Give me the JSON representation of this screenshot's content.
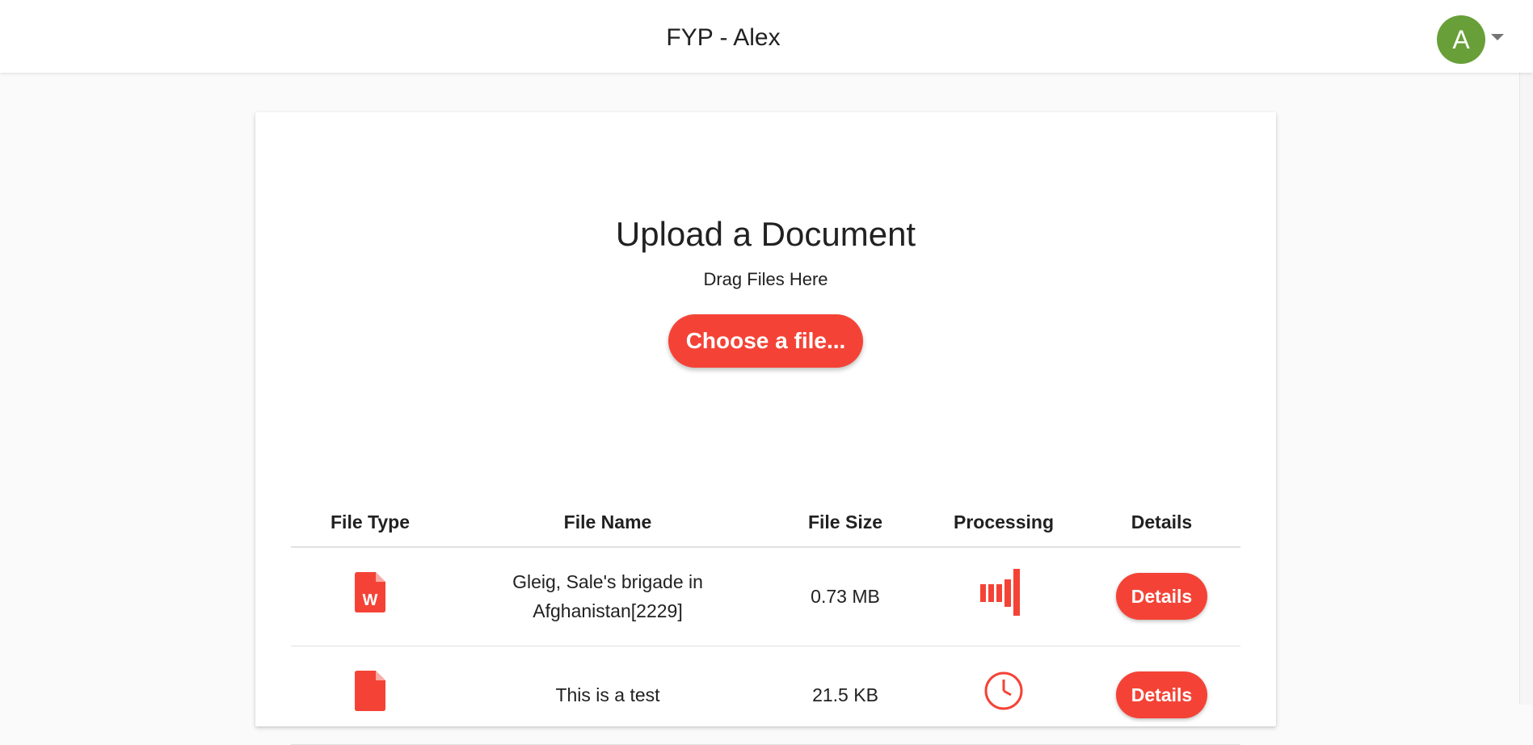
{
  "header": {
    "title": "FYP - Alex",
    "avatar_initial": "A",
    "avatar_color": "#689f38"
  },
  "upload": {
    "title": "Upload a Document",
    "subtitle": "Drag Files Here",
    "choose_button": "Choose a file..."
  },
  "accent_color": "#f44336",
  "table": {
    "columns": [
      "File Type",
      "File Name",
      "File Size",
      "Processing",
      "Details"
    ],
    "rows": [
      {
        "file_type_icon": "word-document-icon",
        "file_name": "Gleig, Sale's brigade in Afghanistan[2229]",
        "file_size": "0.73 MB",
        "processing_icon": "processing-progress-icon",
        "details_label": "Details"
      },
      {
        "file_type_icon": "document-icon",
        "file_name": "This is a test",
        "file_size": "21.5 KB",
        "processing_icon": "clock-icon",
        "details_label": "Details"
      }
    ]
  }
}
